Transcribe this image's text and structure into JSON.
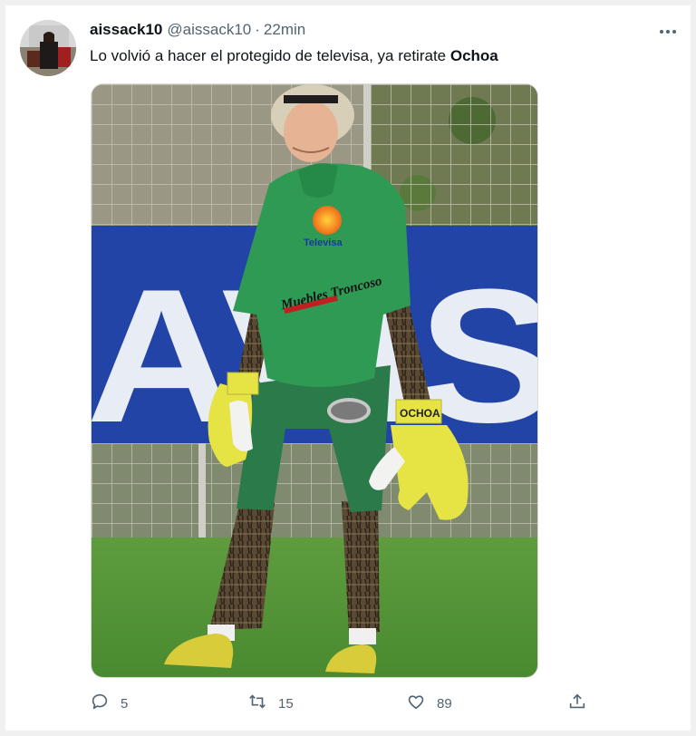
{
  "tweet": {
    "display_name": "aissack10",
    "handle": "@aissack10",
    "separator": "·",
    "time": "22min",
    "text_prefix": "Lo volvió a hacer el protegido de televisa, ya retirate ",
    "text_bold": "Ochoa",
    "more_icon": "ellipsis-icon"
  },
  "media": {
    "banner_text": "AVIS",
    "shirt_logo_text": "Televisa",
    "shirt_sponsor_text": "Muebles Troncoso",
    "glove_text": "OCHOA"
  },
  "actions": {
    "reply_count": "5",
    "retweet_count": "15",
    "like_count": "89"
  },
  "colors": {
    "text": "#0f1419",
    "secondary": "#536471",
    "jersey": "#2e9a54",
    "glove": "#e6e444",
    "banner": "#2244a6"
  }
}
